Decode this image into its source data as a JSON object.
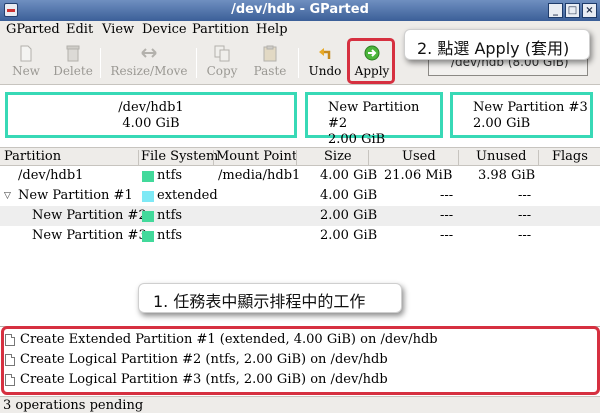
{
  "window": {
    "title": "/dev/hdb - GParted",
    "buttons": [
      "_",
      "□",
      "×"
    ]
  },
  "menu": [
    "GParted",
    "Edit",
    "View",
    "Device",
    "Partition",
    "Help"
  ],
  "toolbar": {
    "new": "New",
    "delete": "Delete",
    "resize_move": "Resize/Move",
    "copy": "Copy",
    "paste": "Paste",
    "undo": "Undo",
    "apply": "Apply"
  },
  "device_selector": {
    "value": "/dev/hdb (8.00 GiB)"
  },
  "callouts": {
    "apply_hint": "2. 點選 Apply (套用)",
    "pending_hint": "1. 任務表中顯示排程中的工作"
  },
  "graphic": [
    {
      "name": "/dev/hdb1",
      "size": "4.00 GiB"
    },
    {
      "name": "New Partition #2",
      "size": "2.00 GiB"
    },
    {
      "name": "New Partition #3",
      "size": "2.00 GiB"
    }
  ],
  "table": {
    "columns": [
      "Partition",
      "File System",
      "Mount Point",
      "Size",
      "Used",
      "Unused",
      "Flags"
    ],
    "rows": [
      {
        "partition": "/dev/hdb1",
        "fs": "ntfs",
        "mount": "/media/hdb1",
        "size": "4.00 GiB",
        "used": "21.06 MiB",
        "unused": "3.98 GiB",
        "flags": ""
      },
      {
        "partition": "New Partition #1",
        "fs": "extended",
        "mount": "",
        "size": "4.00 GiB",
        "used": "---",
        "unused": "---",
        "flags": ""
      },
      {
        "partition": "New Partition #2",
        "fs": "ntfs",
        "mount": "",
        "size": "2.00 GiB",
        "used": "---",
        "unused": "---",
        "flags": ""
      },
      {
        "partition": "New Partition #3",
        "fs": "ntfs",
        "mount": "",
        "size": "2.00 GiB",
        "used": "---",
        "unused": "---",
        "flags": ""
      }
    ]
  },
  "operations": [
    "Create Extended Partition #1 (extended, 4.00 GiB) on /dev/hdb",
    "Create Logical Partition #2 (ntfs, 2.00 GiB) on /dev/hdb",
    "Create Logical Partition #3 (ntfs, 2.00 GiB) on /dev/hdb"
  ],
  "status": "3 operations pending",
  "colors": {
    "ntfs": "#42d99b",
    "extended": "#7ee9f5",
    "highlight": "#d63040",
    "partition_border": "#38d9b6"
  }
}
